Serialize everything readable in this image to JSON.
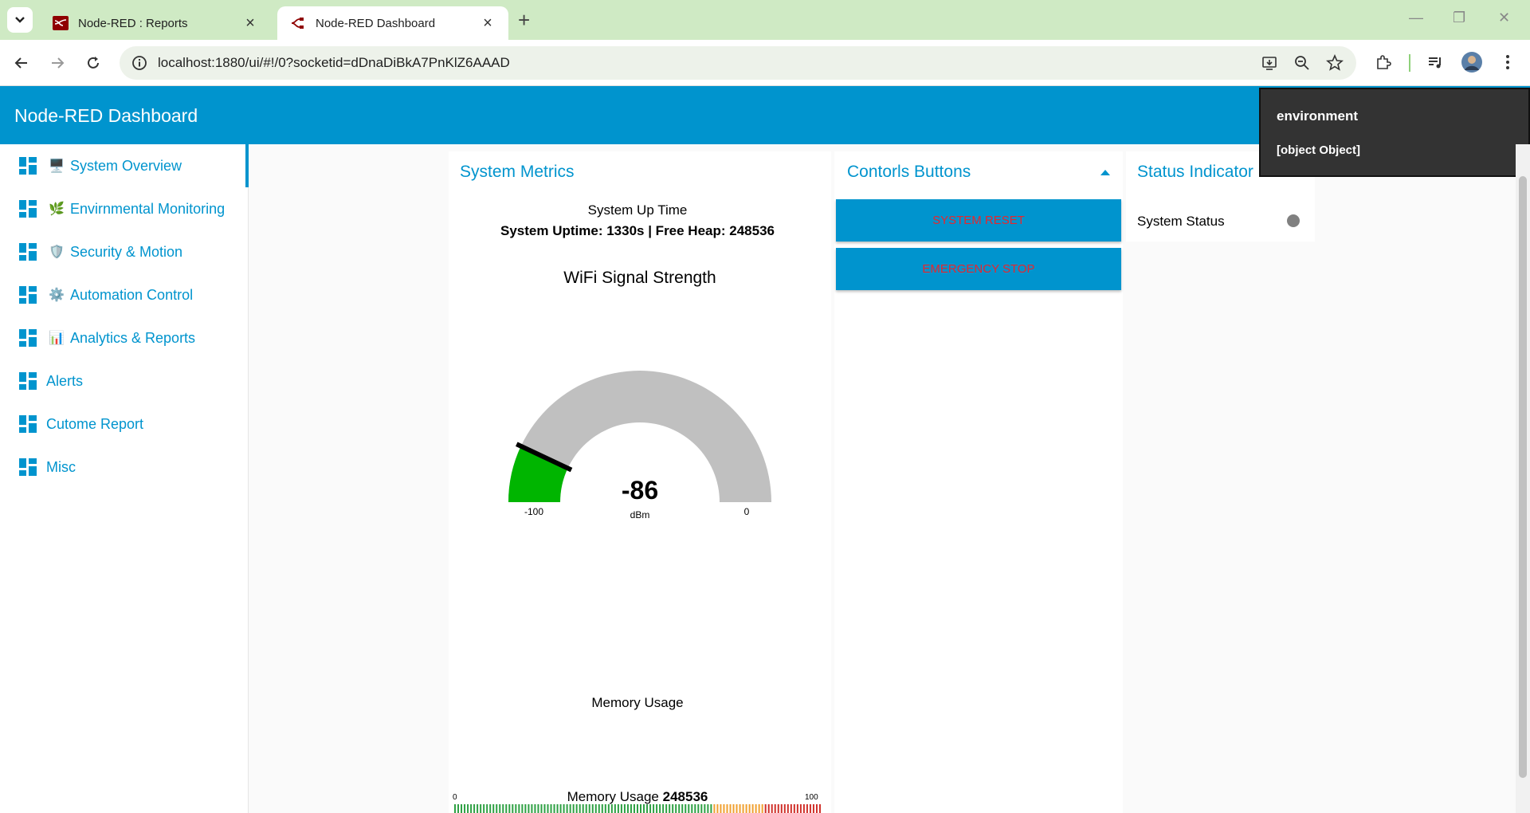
{
  "browser": {
    "tabs": [
      {
        "title": "Node-RED : Reports",
        "active": false
      },
      {
        "title": "Node-RED Dashboard",
        "active": true
      }
    ],
    "new_tab": "+",
    "url": "localhost:1880/ui/#!/0?socketid=dDnaDiBkA7PnKlZ6AAAD"
  },
  "app": {
    "title": "Node-RED Dashboard",
    "accent": "#0094ce"
  },
  "sidebar": {
    "items": [
      {
        "emoji": "🖥️",
        "label": "System Overview",
        "active": true
      },
      {
        "emoji": "🌿",
        "label": "Envirnmental Monitoring"
      },
      {
        "emoji": "🛡️",
        "label": "Security & Motion"
      },
      {
        "emoji": "⚙️",
        "label": "Automation Control"
      },
      {
        "emoji": "📊",
        "label": "Analytics & Reports"
      },
      {
        "emoji": "",
        "label": "Alerts"
      },
      {
        "emoji": "",
        "label": "Cutome Report"
      },
      {
        "emoji": "",
        "label": "Misc"
      }
    ]
  },
  "metrics": {
    "title": "System Metrics",
    "uptime_label": "System Up Time",
    "uptime_value": "System Uptime: 1330s | Free Heap: 248536",
    "wifi": {
      "title": "WiFi Signal Strength",
      "value": -86,
      "value_text": "-86",
      "unit": "dBm",
      "min": -100,
      "max": 0,
      "min_text": "-100",
      "max_text": "0",
      "fill_color": "#00b500",
      "track_color": "#c0c0c0"
    },
    "memory": {
      "title": "Memory Usage",
      "label_prefix": "Memory Usage",
      "value_text": "248536",
      "min_text": "0",
      "max_text": "100"
    }
  },
  "controls": {
    "title": "Contorls Buttons",
    "buttons": [
      "SYSTEM RESET",
      "EMERGENCY STOP"
    ]
  },
  "status": {
    "title": "Status Indicator",
    "label": "System Status",
    "led_color": "#808080"
  },
  "tooltip": {
    "title": "environment",
    "body": "[object Object]"
  }
}
